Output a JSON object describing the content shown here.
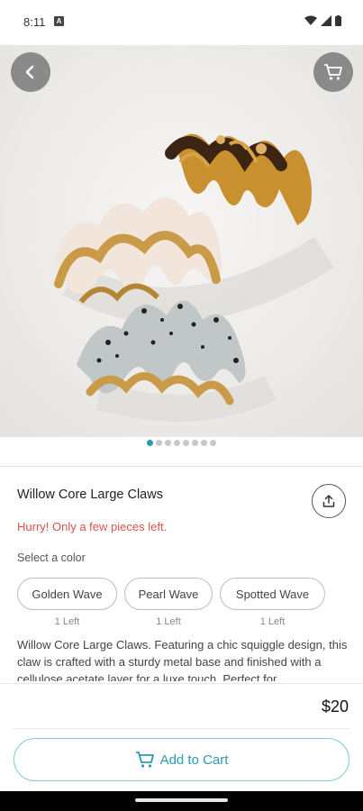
{
  "status_bar": {
    "time": "8:11",
    "notification_icon": "a-letter-icon",
    "icons": [
      "wifi-icon",
      "signal-icon",
      "battery-icon"
    ]
  },
  "nav": {
    "back_icon": "back-arrow-icon",
    "cart_icon": "cart-icon"
  },
  "gallery": {
    "image_description_icon": "hair-claw-product-photo",
    "dots_total": 8,
    "active_dot": 0
  },
  "product": {
    "title": "Willow Core Large Claws",
    "stock_warning": "Hurry! Only a few pieces left.",
    "select_color_label": "Select a color",
    "colors": [
      {
        "label": "Golden Wave",
        "stock": "1 Left"
      },
      {
        "label": "Pearl Wave",
        "stock": "1 Left"
      },
      {
        "label": "Spotted Wave",
        "stock": "1 Left"
      }
    ],
    "description": "Willow Core Large Claws. Featuring a chic squiggle design, this claw is crafted with a sturdy metal base and finished with a cellulose acetate layer for a luxe touch. Perfect for",
    "price": "$20",
    "add_to_cart": "Add to Cart"
  },
  "colors": {
    "accent": "#2a9bb0",
    "warning": "#d9534f"
  }
}
